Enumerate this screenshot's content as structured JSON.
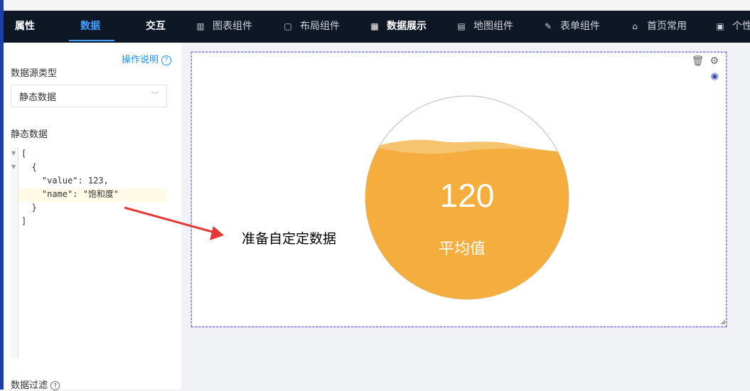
{
  "topbar": {
    "tabs": [
      "属性",
      "数据",
      "交互"
    ],
    "active_tab": "数据",
    "components": [
      {
        "icon": "bar-chart-icon",
        "label": "图表组件"
      },
      {
        "icon": "layout-icon",
        "label": "布局组件"
      },
      {
        "icon": "table-icon",
        "label": "数据展示"
      },
      {
        "icon": "map-grid-icon",
        "label": "地图组件"
      },
      {
        "icon": "form-edit-icon",
        "label": "表单组件"
      },
      {
        "icon": "home-icon",
        "label": "首页常用"
      },
      {
        "icon": "grid-icon",
        "label": "个性"
      }
    ],
    "active_component": "数据展示"
  },
  "panel": {
    "help_link": "操作说明",
    "datasource_type_label": "数据源类型",
    "datasource_type_value": "静态数据",
    "static_data_label": "静态数据",
    "code_lines": [
      "[",
      "  {",
      "    \"value\": 123,",
      "    \"name\": \"饱和度\"",
      "  }",
      "]"
    ],
    "filter_label": "数据过滤"
  },
  "widget": {
    "value": "120",
    "label": "平均值",
    "colors": {
      "fill": "#f5ad3d",
      "wave": "#f6c46e",
      "border": "#6d6df5"
    }
  },
  "annotation": {
    "text": "准备自定定数据",
    "arrow_color": "#e53935"
  }
}
